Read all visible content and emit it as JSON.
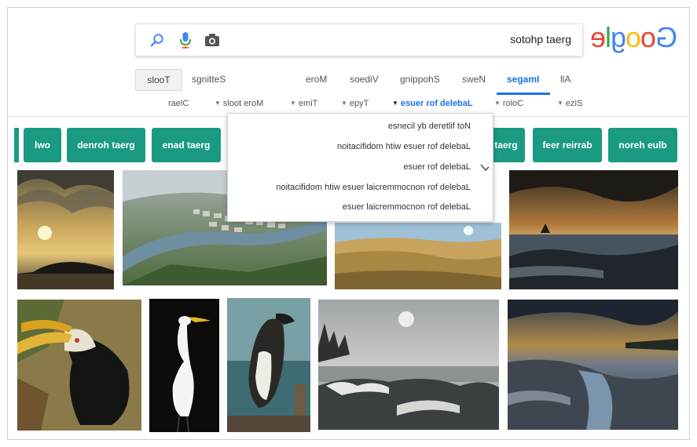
{
  "search": {
    "query": "great photos"
  },
  "logo": {
    "text": "Google"
  },
  "nav": {
    "tabs": [
      "All",
      "Images",
      "News",
      "Shopping",
      "Videos",
      "More",
      "Settings",
      "Tools"
    ],
    "active": "Images"
  },
  "filters": {
    "items": [
      "Size",
      "Color",
      "Labeled for reuse",
      "Type",
      "Time",
      "More tools",
      "Clear"
    ],
    "selected": "Labeled for reuse"
  },
  "license_menu": {
    "options": [
      "Not filtered by license",
      "Labeled for reuse with modification",
      "Labeled for reuse",
      "Labeled for noncommercial reuse with modification",
      "Labeled for noncommercial reuse"
    ],
    "checked": "Labeled for reuse"
  },
  "chips": [
    "blue heron",
    "barrier reef",
    "great",
    "great dane",
    "great horned",
    "owl"
  ],
  "colors": {
    "accent": "#1a73e8",
    "chip": "#1b9a82"
  },
  "images": [
    "sunset-over-sea-with-clouds",
    "aerial-city-along-river",
    "hills-landscape-under-sky",
    "rocky-shore-at-dusk",
    "hornbill-bird",
    "white-egret",
    "great-auk-bird",
    "icy-rocky-shore",
    "rocky-coast-evening"
  ]
}
